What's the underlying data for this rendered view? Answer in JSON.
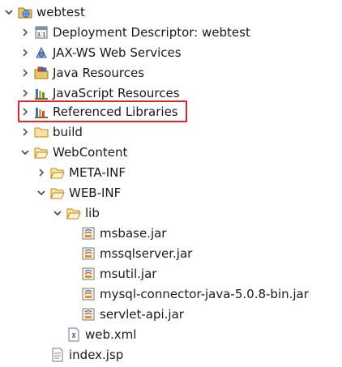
{
  "tree": {
    "project": {
      "label": "webtest",
      "icon": "web-project-icon",
      "expanded": true
    },
    "items": [
      {
        "label": "Deployment Descriptor: webtest",
        "icon": "deployment-descriptor-icon",
        "arrow": "collapsed"
      },
      {
        "label": "JAX-WS Web Services",
        "icon": "web-services-icon",
        "arrow": "collapsed"
      },
      {
        "label": "Java Resources",
        "icon": "java-resources-icon",
        "arrow": "collapsed"
      },
      {
        "label": "JavaScript Resources",
        "icon": "javascript-resources-icon",
        "arrow": "collapsed"
      },
      {
        "label": "Referenced Libraries",
        "icon": "library-icon",
        "arrow": "collapsed",
        "highlighted": true
      },
      {
        "label": "build",
        "icon": "folder-icon",
        "arrow": "collapsed"
      },
      {
        "label": "WebContent",
        "icon": "folder-open-icon",
        "arrow": "expanded"
      },
      {
        "label": "META-INF",
        "icon": "folder-icon",
        "arrow": "collapsed"
      },
      {
        "label": "WEB-INF",
        "icon": "folder-open-icon",
        "arrow": "expanded"
      },
      {
        "label": "lib",
        "icon": "folder-open-icon",
        "arrow": "expanded"
      },
      {
        "label": "msbase.jar",
        "icon": "jar-file-icon"
      },
      {
        "label": "mssqlserver.jar",
        "icon": "jar-file-icon"
      },
      {
        "label": "msutil.jar",
        "icon": "jar-file-icon"
      },
      {
        "label": "mysql-connector-java-5.0.8-bin.jar",
        "icon": "jar-file-icon"
      },
      {
        "label": "servlet-api.jar",
        "icon": "jar-file-icon"
      },
      {
        "label": "web.xml",
        "icon": "xml-file-icon"
      },
      {
        "label": "index.jsp",
        "icon": "jsp-file-icon"
      }
    ]
  },
  "colors": {
    "highlight_border": "#e0262b",
    "folder": "#e8b84a",
    "arrow": "#555555"
  }
}
